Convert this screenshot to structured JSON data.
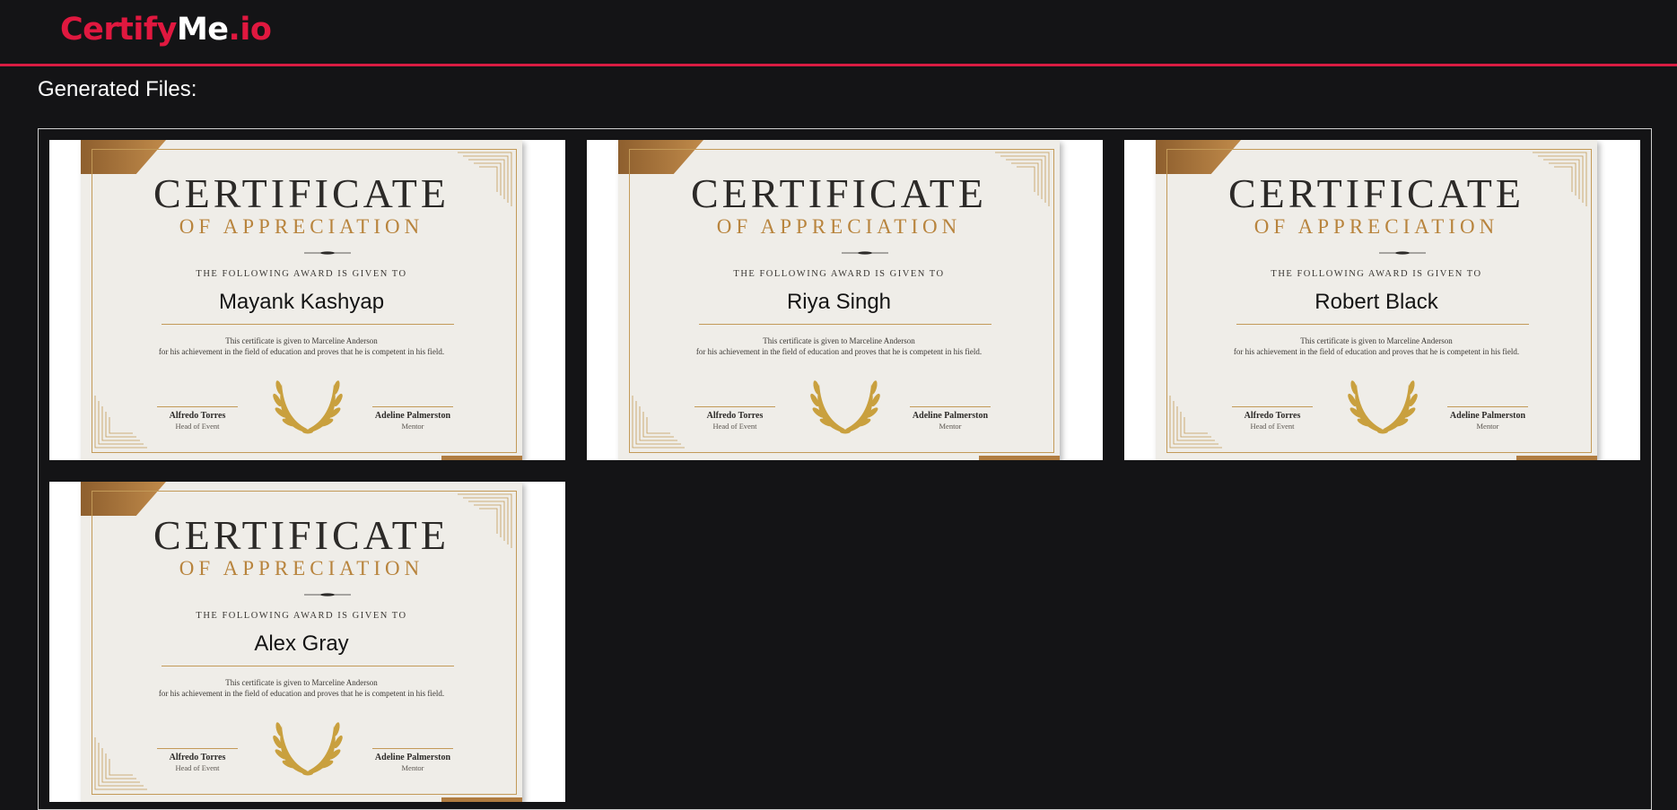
{
  "header": {
    "logo_part1": "Certify",
    "logo_part2": "Me",
    "logo_part3": ".io"
  },
  "page": {
    "title": "Generated Files:"
  },
  "certificate": {
    "title": "CERTIFICATE",
    "subtitle": "OF APPRECIATION",
    "given_to": "THE FOLLOWING AWARD IS GIVEN TO",
    "desc_line1": "This certificate is given to Marceline Anderson",
    "desc_line2": "for his achievement in the field of education and proves that he is competent in his field.",
    "signer1_name": "Alfredo Torres",
    "signer1_role": "Head of Event",
    "signer2_name": "Adeline Palmerston",
    "signer2_role": "Mentor"
  },
  "files": [
    {
      "recipient": "Mayank Kashyap"
    },
    {
      "recipient": "Riya Singh"
    },
    {
      "recipient": "Robert Black"
    },
    {
      "recipient": "Alex Gray"
    }
  ],
  "colors": {
    "accent": "#e0183f",
    "background": "#141416",
    "gold": "#b8843d"
  }
}
